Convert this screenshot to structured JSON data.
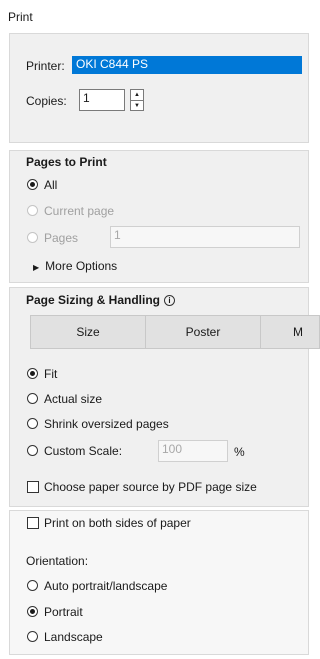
{
  "window": {
    "title": "Print"
  },
  "printer": {
    "label": "Printer:",
    "value": "OKI C844 PS"
  },
  "copies": {
    "label": "Copies:",
    "value": "1"
  },
  "pages_to_print": {
    "heading": "Pages to Print",
    "all": "All",
    "current_page": "Current page",
    "pages": "Pages",
    "pages_value": "1",
    "more_options": "More Options"
  },
  "sizing": {
    "heading": "Page Sizing & Handling",
    "buttons": [
      "Size",
      "Poster",
      "M"
    ],
    "fit": "Fit",
    "actual_size": "Actual size",
    "shrink": "Shrink oversized pages",
    "custom_scale": "Custom Scale:",
    "custom_scale_value": "100",
    "percent": "%",
    "paper_source": "Choose paper source by PDF page size"
  },
  "duplex": {
    "both_sides": "Print on both sides of paper"
  },
  "orientation": {
    "label": "Orientation:",
    "auto": "Auto portrait/landscape",
    "portrait": "Portrait",
    "landscape": "Landscape"
  }
}
